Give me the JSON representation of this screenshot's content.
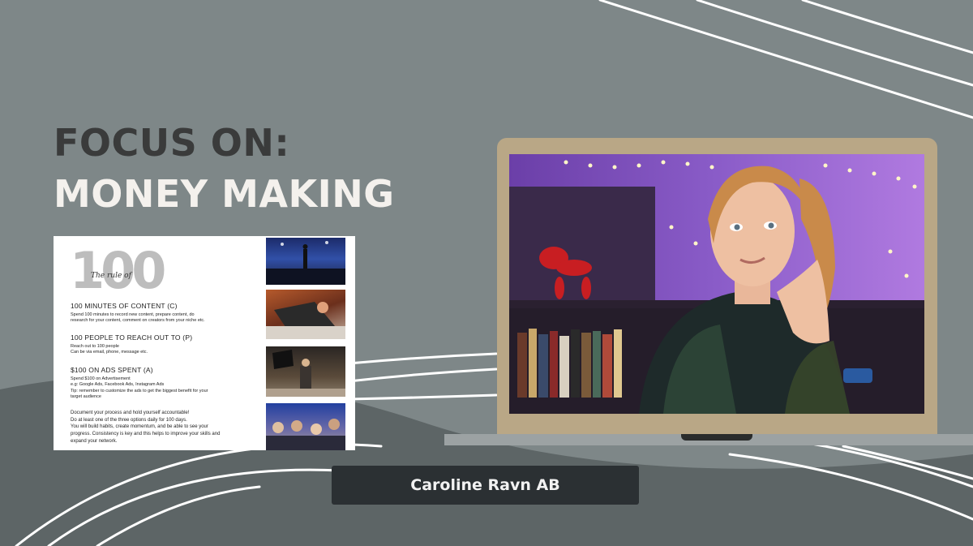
{
  "heading": {
    "line1": "FOCUS ON:",
    "line2": "MONEY MAKING"
  },
  "document": {
    "big_number": "100",
    "rule_of": "The rule of",
    "sections": [
      {
        "title": "100 MINUTES OF CONTENT (C)",
        "body": "Spend 100 minutes to record new content, prepare content, do\nresearch for your content, comment on creators from your niche etc."
      },
      {
        "title": "100 PEOPLE TO REACH OUT TO (P)",
        "body": "Reach out to 100 people\nCan be via email, phone, message etc."
      },
      {
        "title": "$100 ON ADS SPENT (A)",
        "body": "Spend $100 on Advertisement\ne.g: Google Ads, Facebook Ads, Instagram Ads\nTip: remember to customize the ads to get the biggest benefit for your\ntarget audience"
      }
    ],
    "closing": "Document your process and hold yourself accountable!\nDo at least one of the three options daily for 100 days.\nYou will build habits, create momentum, and be able to see your\nprogress. Consistency is key and this helps to improve your skills and\nexpand your network."
  },
  "presenter": {
    "name": "Caroline Ravn AB"
  },
  "colors": {
    "background": "#7e8788",
    "laptop_frame": "#b9a786",
    "badge": "#2b3033",
    "dark_heading": "#3a3b3b",
    "light_heading": "#f4f1ed"
  }
}
